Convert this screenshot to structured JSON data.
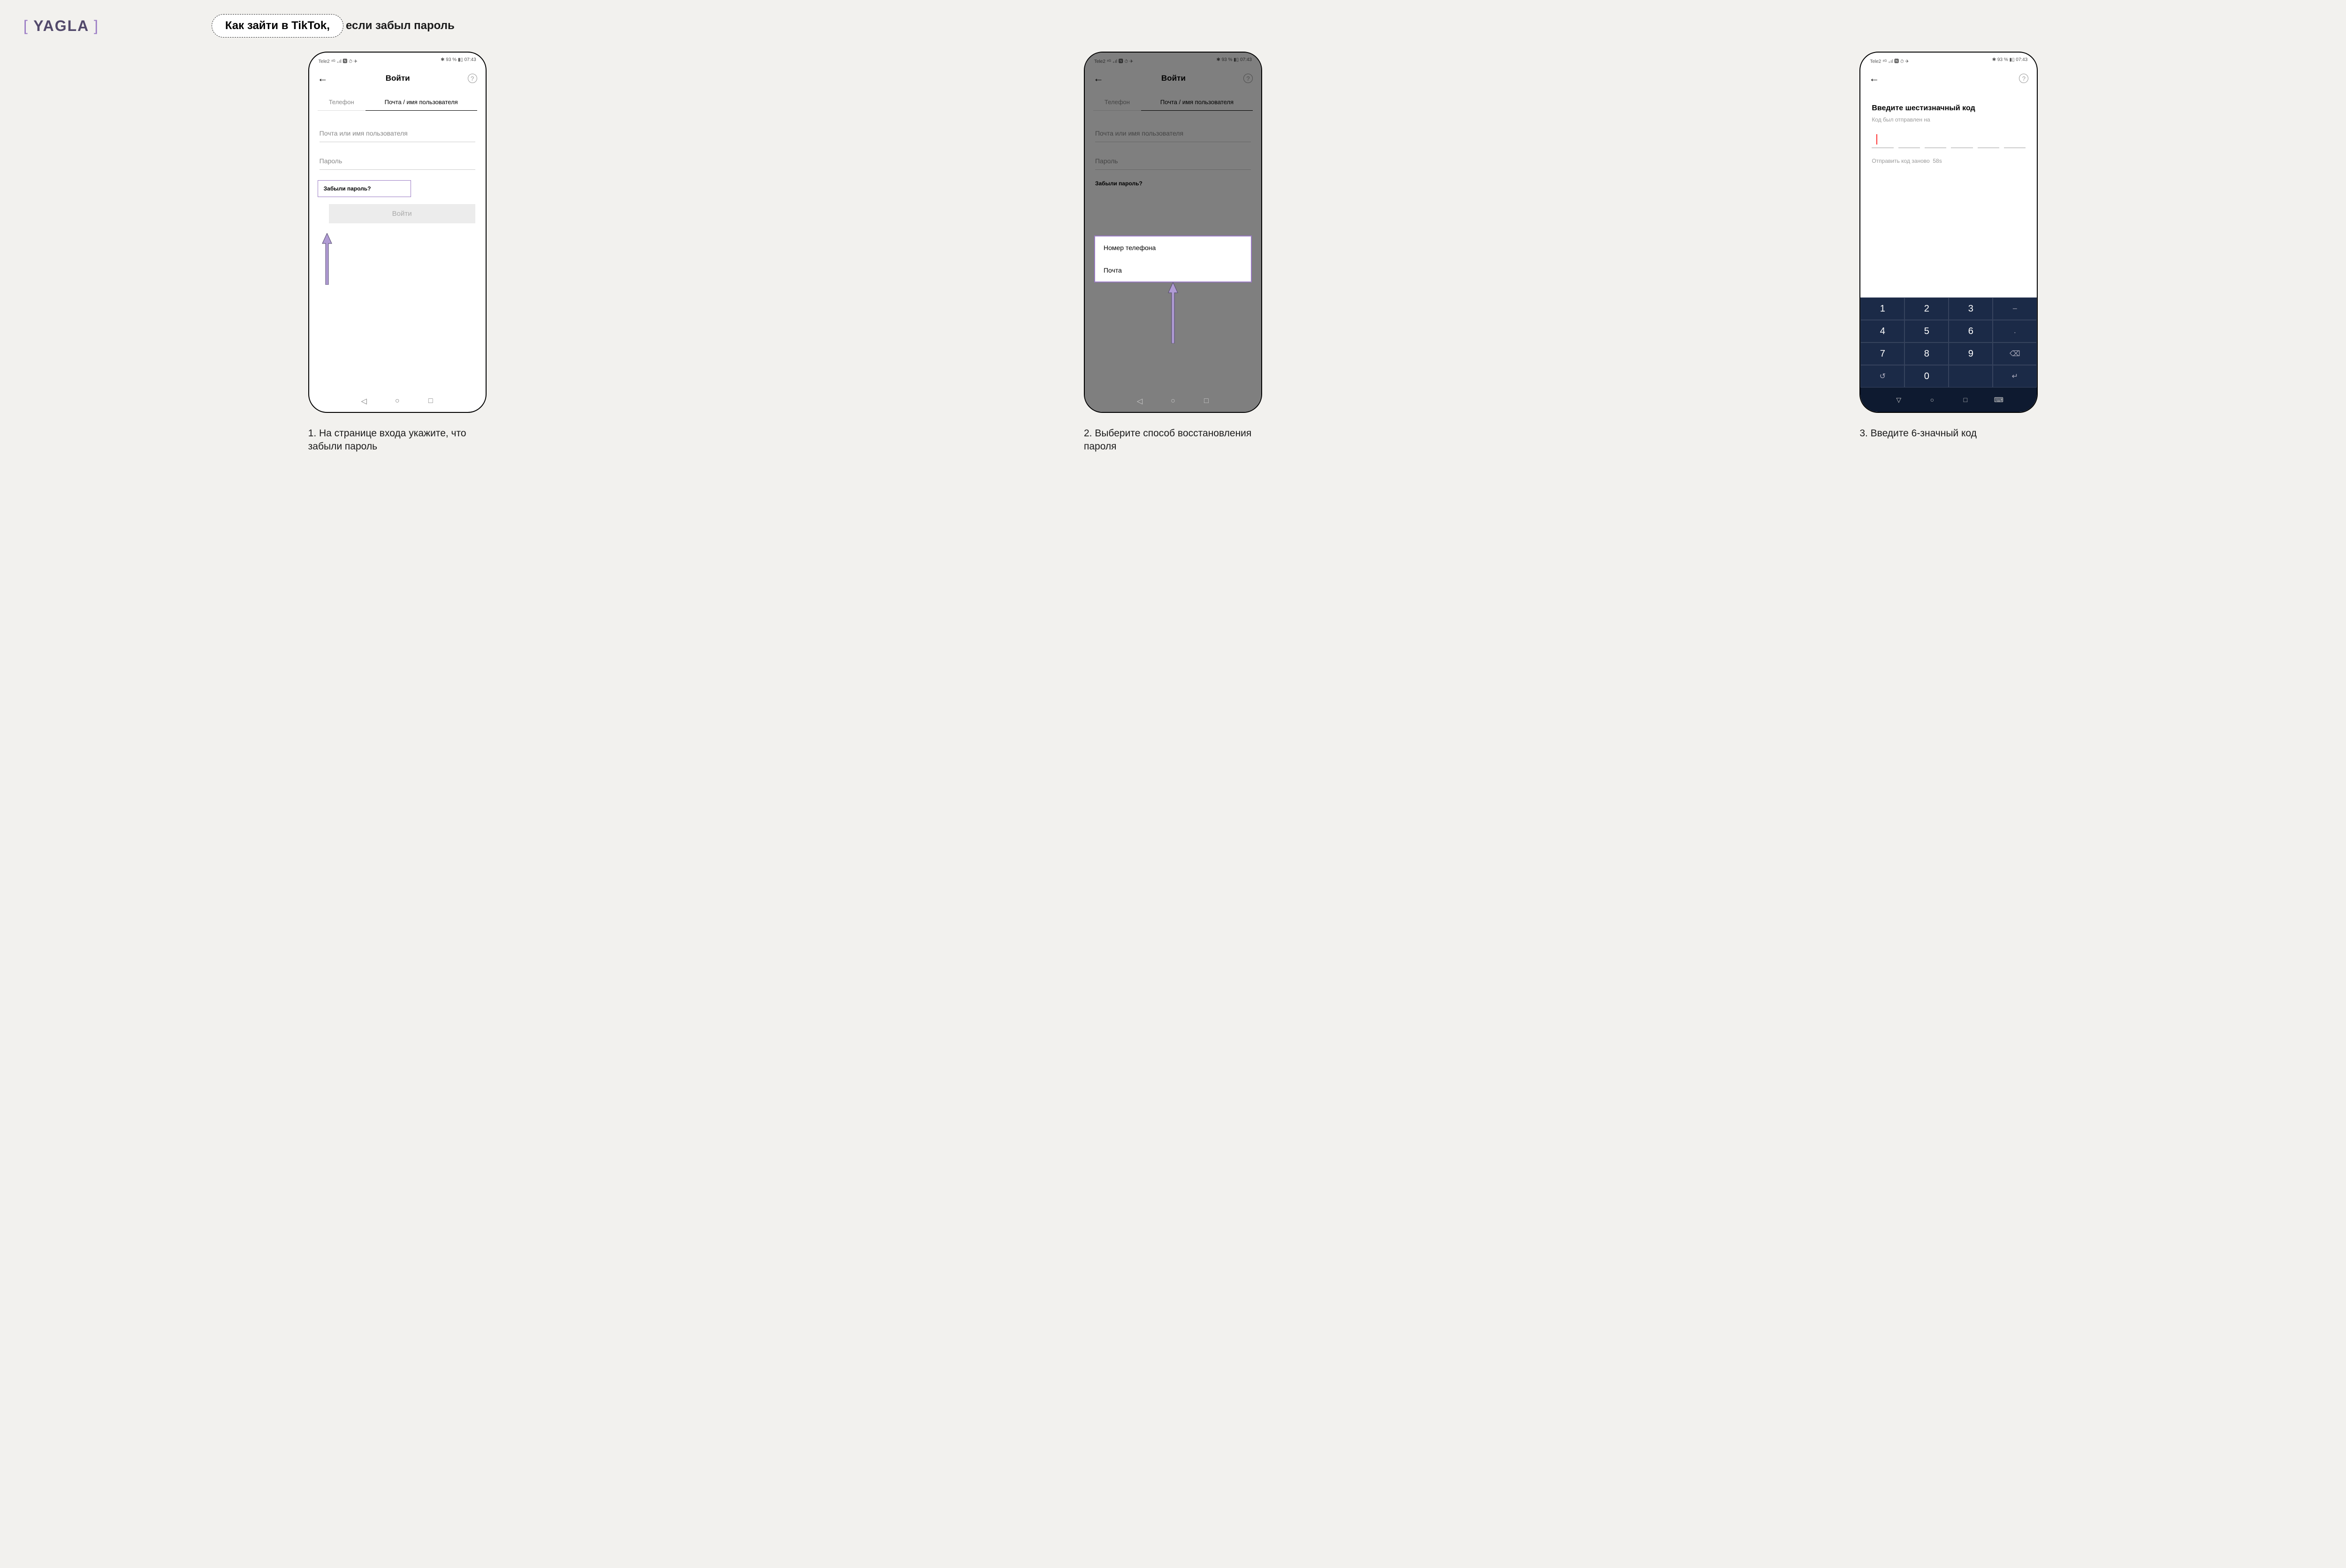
{
  "logo": {
    "bracket_open": "[",
    "name": "YAGLA",
    "bracket_close": "]"
  },
  "title": {
    "pill": "Как зайти в TikTok,",
    "rest": "если забыл пароль"
  },
  "statusbar": {
    "left": "Tele2 ⁴ᴳ ₊ıl 🅽 ⏱ ✈",
    "right": "✱ 93 % ▮▯ 07:43"
  },
  "screen": {
    "title": "Войти",
    "tab_phone": "Телефон",
    "tab_email": "Почта / имя пользователя",
    "input_user": "Почта или имя пользователя",
    "input_pass": "Пароль",
    "forgot": "Забыли пароль?",
    "login_btn": "Войти"
  },
  "popup": {
    "phone": "Номер телефона",
    "email": "Почта"
  },
  "code": {
    "title": "Введите шестизначный код",
    "sub": "Код был отправлен на",
    "resend": "Отправить код заново",
    "timer": "58s"
  },
  "keypad": [
    "1",
    "2",
    "3",
    "–",
    "4",
    "5",
    "6",
    ".",
    "7",
    "8",
    "9",
    "⌫",
    "↺",
    "0",
    " ",
    "↵"
  ],
  "captions": {
    "s1": "1. На странице входа укажите, что забыли пароль",
    "s2": "2. Выберите способ восстановления пароля",
    "s3": "3. Введите 6-значный код"
  }
}
